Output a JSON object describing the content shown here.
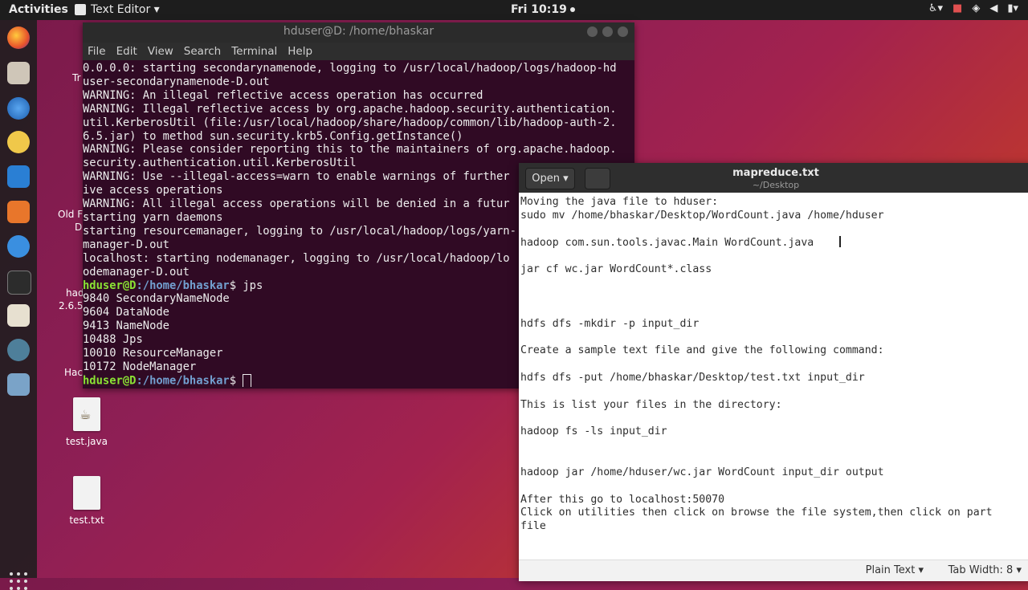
{
  "topbar": {
    "activities": "Activities",
    "app_menu": "Text Editor ▾",
    "clock": "Fri 10:19"
  },
  "terminal": {
    "title": "hduser@D: /home/bhaskar",
    "menu": [
      "File",
      "Edit",
      "View",
      "Search",
      "Terminal",
      "Help"
    ],
    "lines": [
      "0.0.0.0: starting secondarynamenode, logging to /usr/local/hadoop/logs/hadoop-hd",
      "user-secondarynamenode-D.out",
      "WARNING: An illegal reflective access operation has occurred",
      "WARNING: Illegal reflective access by org.apache.hadoop.security.authentication.",
      "util.KerberosUtil (file:/usr/local/hadoop/share/hadoop/common/lib/hadoop-auth-2.",
      "6.5.jar) to method sun.security.krb5.Config.getInstance()",
      "WARNING: Please consider reporting this to the maintainers of org.apache.hadoop.",
      "security.authentication.util.KerberosUtil",
      "WARNING: Use --illegal-access=warn to enable warnings of further",
      "ive access operations",
      "WARNING: All illegal access operations will be denied in a futur",
      "starting yarn daemons",
      "starting resourcemanager, logging to /usr/local/hadoop/logs/yarn-",
      "manager-D.out",
      "localhost: starting nodemanager, logging to /usr/local/hadoop/lo",
      "odemanager-D.out"
    ],
    "prompt_user": "hduser@D",
    "prompt_path": ":/home/bhaskar",
    "prompt_symbol": "$ ",
    "command": "jps",
    "jps_output": [
      "9840 SecondaryNameNode",
      "9604 DataNode",
      "9413 NameNode",
      "10488 Jps",
      "10010 ResourceManager",
      "10172 NodeManager"
    ]
  },
  "editor": {
    "open_label": "Open ▾",
    "title": "mapreduce.txt",
    "subtitle": "~/Desktop",
    "lines": [
      "Moving the java file to hduser:",
      "sudo mv /home/bhaskar/Desktop/WordCount.java /home/hduser",
      "",
      "hadoop com.sun.tools.javac.Main WordCount.java",
      "",
      "jar cf wc.jar WordCount*.class",
      "",
      "",
      "",
      "hdfs dfs -mkdir -p input_dir",
      "",
      "Create a sample text file and give the following command:",
      "",
      "hdfs dfs -put /home/bhaskar/Desktop/test.txt input_dir",
      "",
      "This is list your files in the directory:",
      "",
      "hadoop fs -ls input_dir",
      "",
      "",
      "hadoop jar /home/hduser/wc.jar WordCount input_dir output",
      "",
      "After this go to localhost:50070",
      "Click on utilities then click on browse the file system,then click on part",
      "file"
    ],
    "status_lang": "Plain Text ▾",
    "status_tab": "Tab Width: 8 ▾"
  },
  "desktop": {
    "icons": [
      {
        "label": "test.java"
      },
      {
        "label": "test.txt"
      }
    ],
    "partial_labels": [
      "Tr",
      "Old F",
      "D",
      "had",
      "2.6.5",
      "Hac"
    ]
  },
  "colors": {
    "terminal_bg": "#300a24",
    "prompt_user": "#8ae234",
    "prompt_path": "#729fcf",
    "topbar_bg": "#1d1d1d"
  }
}
